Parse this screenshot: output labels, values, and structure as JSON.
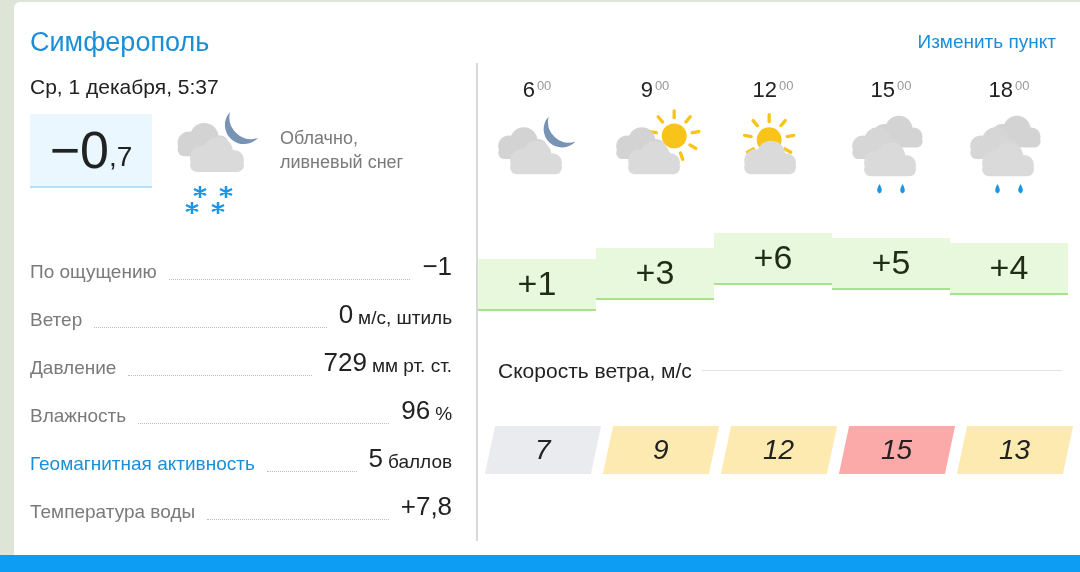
{
  "header": {
    "city": "Симферополь",
    "change_link": "Изменить пункт"
  },
  "current": {
    "datetime": "Ср, 1 декабря, 5:37",
    "temperature": "−0$_{,7}$",
    "condition": "Облачно,\nливневый снег"
  },
  "details": [
    {
      "kind": "text",
      "label": "По ощущению",
      "value": "−1"
    },
    {
      "kind": "text",
      "label": "Ветер",
      "value": "0",
      "unit": "м/с, штиль"
    },
    {
      "kind": "text",
      "label": "Давление",
      "value": "729",
      "unit": "мм рт. ст."
    },
    {
      "kind": "text",
      "label": "Влажность",
      "value": "96",
      "unit": "%"
    },
    {
      "kind": "link",
      "label": "Геомагнитная активность",
      "value": "5",
      "unit": "баллов"
    },
    {
      "kind": "text",
      "label": "Температура воды",
      "value": "+7,8"
    }
  ],
  "hourly": [
    {
      "time": "6$^{00}$",
      "kind": "night",
      "temperature": "+1"
    },
    {
      "time": "9$^{00}$",
      "kind": "partsun",
      "temperature": "+3"
    },
    {
      "time": "12$^{00}$",
      "kind": "sun",
      "temperature": "+6"
    },
    {
      "time": "15$^{00}$",
      "kind": "rain",
      "temperature": "+5"
    },
    {
      "time": "18$^{00}$",
      "kind": "rain",
      "temperature": "+4"
    }
  ],
  "wind": {
    "title": "Скорость ветра, м/с",
    "values": [
      {
        "value": "7",
        "color": "#e9ebee"
      },
      {
        "value": "9",
        "color": "#fdeab0"
      },
      {
        "value": "12",
        "color": "#fdeab0"
      },
      {
        "value": "15",
        "color": "#fba9a9"
      },
      {
        "value": "13",
        "color": "#fdeab0"
      }
    ]
  }
}
